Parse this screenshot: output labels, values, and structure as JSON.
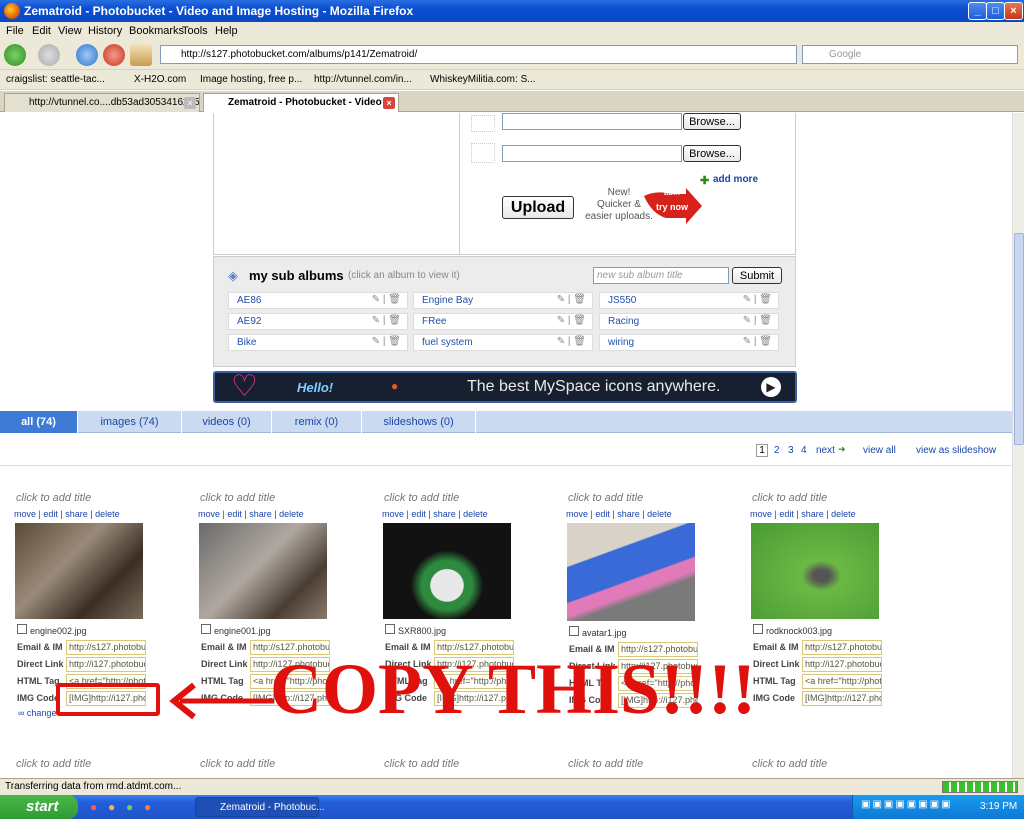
{
  "window": {
    "title": "Zematroid - Photobucket - Video and Image Hosting - Mozilla Firefox"
  },
  "menu": [
    "File",
    "Edit",
    "View",
    "History",
    "Bookmarks",
    "Tools",
    "Help"
  ],
  "nav": {
    "url": "http://s127.photobucket.com/albums/p141/Zematroid/",
    "search_placeholder": "Google"
  },
  "bookmarks": [
    "craigslist: seattle-tac...",
    "X-H2O.com",
    "Image hosting, free p...",
    "http://vtunnel.com/in...",
    "WhiskeyMilitia.com: S..."
  ],
  "tabs": [
    {
      "label": "http://vtunnel.co....db53ad3053416235"
    },
    {
      "label": "Zematroid - Photobucket - Video ..."
    }
  ],
  "upload": {
    "browse1": "Browse...",
    "browse2": "Browse...",
    "add_more": "add more",
    "upload_button": "Upload",
    "promo_line1": "New!",
    "promo_line2": "Quicker &",
    "promo_line3": "easier uploads.",
    "promo_badge": "BETA",
    "promo_cta": "try now"
  },
  "sub_albums": {
    "title": "my sub albums",
    "hint": "(click an album to view it)",
    "new_placeholder": "new sub album title",
    "submit": "Submit",
    "items": [
      "AE86",
      "Engine Bay",
      "JS550",
      "AE92",
      "FRee",
      "Racing",
      "Bike",
      "fuel system",
      "wiring"
    ]
  },
  "banner": {
    "text": "The best MySpace icons anywhere.",
    "hello": "Hello!"
  },
  "filters": [
    "all (74)",
    "images (74)",
    "videos (0)",
    "remix (0)",
    "slideshows (0)"
  ],
  "pager": {
    "pages": [
      "1",
      "2",
      "3",
      "4"
    ],
    "next": "next",
    "view_all": "view all",
    "slideshow": "view as slideshow"
  },
  "media": {
    "click_title": "click to add title",
    "actions": [
      "move",
      "edit",
      "share",
      "delete"
    ],
    "labels": [
      "Email & IM",
      "Direct Link",
      "HTML Tag",
      "IMG Code"
    ],
    "items": [
      {
        "file": "engine002.jpg",
        "email": "http://s127.photobuc",
        "direct": "http://i127.photobuc",
        "html": "<a href=\"http://photo",
        "img": "[IMG]http://i127.pho"
      },
      {
        "file": "engine001.jpg",
        "email": "http://s127.photobuc",
        "direct": "http://i127.photobuc",
        "html": "<a href=\"http://photo",
        "img": "[IMG]http://i127.pho"
      },
      {
        "file": "SXR800.jpg",
        "email": "http://s127.photobuc",
        "direct": "http://i127.photobuc",
        "html": "<a href=\"http://photo",
        "img": "[IMG]http://i127.pho"
      },
      {
        "file": "avatar1.jpg",
        "email": "http://s127.photobuc",
        "direct": "http://i127.photobuc",
        "html": "<a href=\"http://photo",
        "img": "[IMG]http://i127.pho"
      },
      {
        "file": "rodknock003.jpg",
        "email": "http://s127.photobuc",
        "direct": "http://i127.photobuc",
        "html": "<a href=\"http://photo",
        "img": "[IMG]http://i127.pho"
      }
    ],
    "change_link": "change"
  },
  "annotation": {
    "text": "COPY THIS!!!!",
    "color": "#e0100c"
  },
  "status": {
    "text": "Transferring data from rmd.atdmt.com..."
  },
  "taskbar": {
    "start": "start",
    "item": "Zematroid - Photobuc...",
    "clock": "3:19 PM"
  }
}
